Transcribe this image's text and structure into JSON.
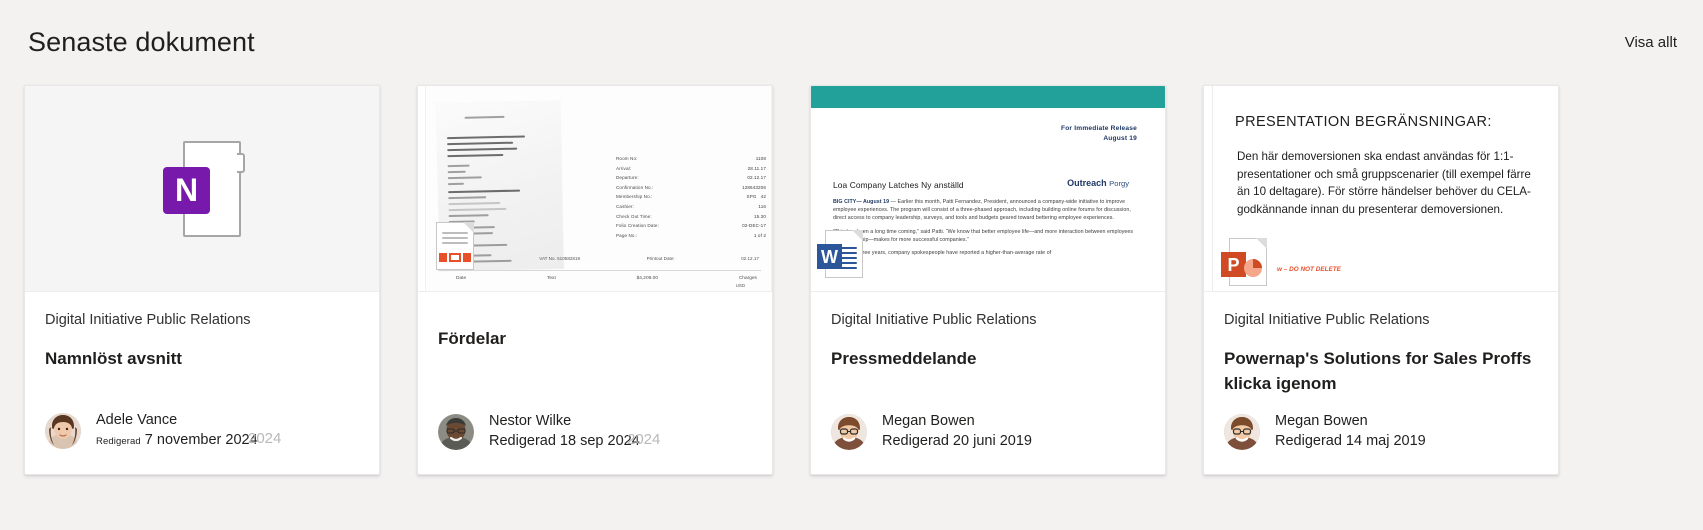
{
  "header": {
    "title": "Senaste dokument",
    "view_all_label": "Visa allt"
  },
  "cards": [
    {
      "source": "Digital Initiative Public Relations",
      "name": "Namnlöst avsnitt",
      "person": "Adele Vance",
      "edited_prefix": "Redigerad",
      "edited_date": "7 november 2024",
      "edited_full": "Redigerad 7 november 2024",
      "ghost_year": "2024",
      "app": "onenote",
      "app_letter": "N",
      "app_color": "#7719aa",
      "thumb_kind": "onenote-icon"
    },
    {
      "source": "",
      "name": "Fördelar",
      "person": "Nestor Wilke",
      "edited_prefix": "Redigerad",
      "edited_date": "18 sep 2024",
      "edited_full": "Redigerad 18 sep 2024",
      "ghost_year": "2024",
      "app": "pdf",
      "app_letter": "",
      "app_color": "#e8502a",
      "thumb_kind": "hotel-receipt-scan",
      "receipt": {
        "left_block": [
          "CASPIT NO: 3450003b",
          "VER:        PDO-0112-69",
          "BUS NUM:       05146022",
          "02-12-17       15:30",
          "CARD:",
          "Amex",
          "CARD NUM:",
          "2000",
          "RECEIPT: 37001019",
          "TRAN TYPE:",
          "Reversed Debit",
          "Renu U 5053160",
          "TRAN CODE:",
          "Regular",
          "CURREN: USD",
          "CREDIT TERM:",
          "Regular",
          "AMNT:   1209.00",
          "THANK YOU +",
          "COME AGAIN +"
        ],
        "fields": [
          {
            "label": "Room No:",
            "value": "1108"
          },
          {
            "label": "Arrival:",
            "value": "28.11.17"
          },
          {
            "label": "Departure:",
            "value": "02.12.17"
          },
          {
            "label": "Confirmation No.:",
            "value": "128643206"
          },
          {
            "label": "Membership No.:",
            "value": "SPG      42"
          },
          {
            "label": "Cashier:",
            "value": "116"
          },
          {
            "label": "Check Out Time:",
            "value": "15.30"
          },
          {
            "label": "Folio Creation Date:",
            "value": "02-DEC-17"
          },
          {
            "label": "Page No.:",
            "value": "1 of 2"
          }
        ],
        "footer_row": [
          "Tel Aviv Hotel,",
          "VAT No. 510582819",
          "Printout Date:",
          "02.12.17"
        ],
        "table_header": [
          "Date",
          "Text",
          "$4,209.00",
          "Charges"
        ],
        "currency": "USD"
      }
    },
    {
      "source": "Digital Initiative Public Relations",
      "name": "Pressmeddelande",
      "person": "Megan Bowen",
      "edited_prefix": "Redigerad",
      "edited_date": "20 juni 2019",
      "edited_full": "Redigerad 20 juni 2019",
      "ghost_year": "",
      "app": "word",
      "app_letter": "W",
      "app_color": "#2b579a",
      "thumb_kind": "word-press-release",
      "banner_color": "#22a19a",
      "press": {
        "immediate_line1": "For Immediate Release",
        "immediate_line2": "August 19",
        "headline": "Loa Company Latches Ny anställd",
        "brand_bold": "Outreach",
        "brand_light": "Porgy",
        "lede_bold": "BIG CITY— August 19",
        "paragraph1": "— Earlier this month, Patti Fernandez, President, announced a company-wide initiative to improve employee experiences. The program will consist of a three-phased approach, including building online forums for discussion, direct access to company leadership, surveys, and tools and budgets geared toward bettering employee experiences.",
        "paragraph2": "“This has been a long time coming,” said Patti. “We know that better employee life—and more interaction between employees and leadership—makes for more successful companies.”",
        "paragraph3": "In the last three years, company spokespeople have reported a higher-than-average rate of"
      }
    },
    {
      "source": "Digital Initiative Public Relations",
      "name": "Powernap's Solutions for Sales Proffs klicka igenom",
      "person": "Megan Bowen",
      "edited_prefix": "Redigerad",
      "edited_date": "14 maj 2019",
      "edited_full": "Redigerad 14 maj 2019",
      "ghost_year": "",
      "app": "powerpoint",
      "app_letter": "P",
      "app_color": "#d04a24",
      "thumb_kind": "powerpoint-slide",
      "slide": {
        "title": "PRESENTATION  BEGRÄNSNINGAR:",
        "body": "Den här demoversionen ska endast användas för 1:1-presentationer och små gruppscenarier (till exempel färre än 10 deltagare). För större händelser behöver du CELA-godkännande innan du presenterar demoversionen.",
        "footnote": "w – DO NOT DELETE"
      }
    }
  ],
  "colors": {
    "page_background": "#f3f2f1",
    "card_background": "#ffffff",
    "text_primary": "#201f1e",
    "onenote_purple": "#7719aa",
    "word_blue": "#2b579a",
    "powerpoint_orange": "#d04a24",
    "pdf_orange": "#e8502a",
    "teal_banner": "#22a19a"
  }
}
